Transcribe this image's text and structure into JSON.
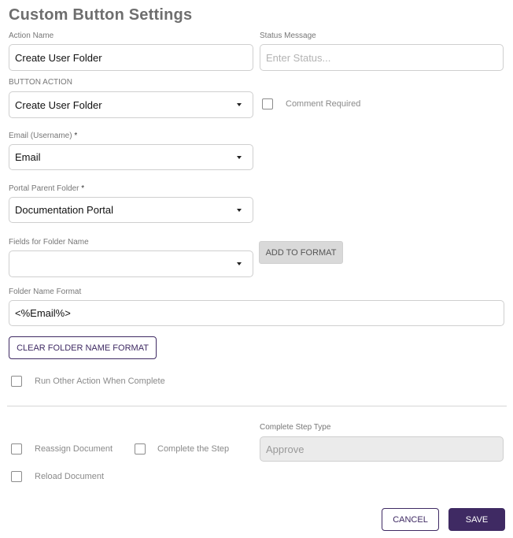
{
  "title": "Custom Button Settings",
  "action_name": {
    "label": "Action Name",
    "value": "Create User Folder"
  },
  "status_message": {
    "label": "Status Message",
    "placeholder": "Enter Status..."
  },
  "button_action": {
    "label": "BUTTON ACTION",
    "value": "Create User Folder"
  },
  "comment_required": {
    "label": "Comment Required",
    "checked": false
  },
  "email_username": {
    "label": "Email (Username)",
    "required_marker": "*",
    "value": "Email"
  },
  "portal_parent_folder": {
    "label": "Portal Parent Folder",
    "required_marker": "*",
    "value": "Documentation Portal"
  },
  "fields_for_folder_name": {
    "label": "Fields for Folder Name",
    "value": ""
  },
  "add_to_format_label": "ADD TO FORMAT",
  "folder_name_format": {
    "label": "Folder Name Format",
    "value": "<%Email%>"
  },
  "clear_format_label": "CLEAR FOLDER NAME FORMAT",
  "run_other_action": {
    "label": "Run Other Action When Complete",
    "checked": false
  },
  "reassign_document": {
    "label": "Reassign Document",
    "checked": false
  },
  "complete_the_step": {
    "label": "Complete the Step",
    "checked": false
  },
  "complete_step_type": {
    "label": "Complete Step Type",
    "value": "Approve"
  },
  "reload_document": {
    "label": "Reload Document",
    "checked": false
  },
  "cancel_label": "CANCEL",
  "save_label": "SAVE",
  "colors": {
    "primary": "#3f2a63",
    "title": "#6e6e6e",
    "border": "#cfcfcf"
  }
}
